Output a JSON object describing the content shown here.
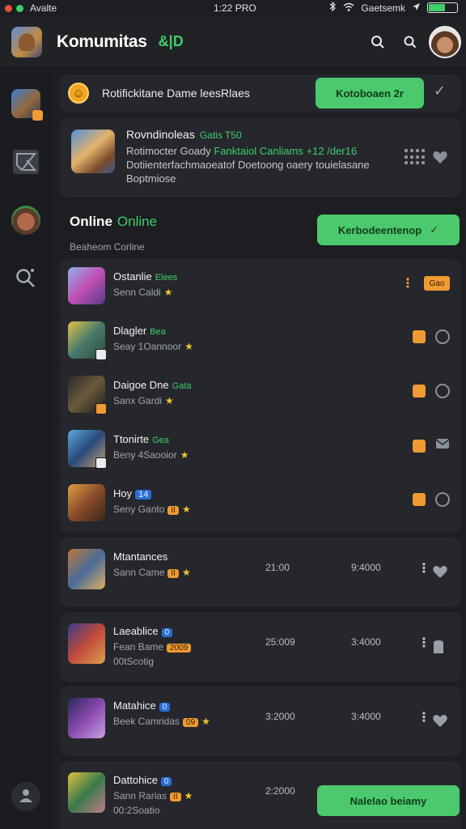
{
  "status": {
    "carrier": "Avalte",
    "time": "1:22 PRO",
    "network": "Gaetsemk"
  },
  "header": {
    "title": "Komumitas",
    "tag": "&|D"
  },
  "top_card": {
    "title": "Rotifickitane Dame leesRlaes",
    "button": "Kotoboaen 2r"
  },
  "featured": {
    "title": "Rovndinoleas",
    "title_tag": "Gatis T50",
    "line1_prefix": "Rotimocter Goady",
    "line1_highlight": "Fanktaiol Canliams",
    "line1_suffix": "+12 /der16",
    "line2": "Dotiienterfachmaoeatof Doetoong oaery touielasane",
    "line3": "Boptmiose"
  },
  "online": {
    "title": "Online",
    "title_tag": "Online",
    "subtitle": "Beaheom Corline",
    "button": "Kerbodeentenop"
  },
  "list": [
    {
      "name": "Ostanlie",
      "tag": "Elees",
      "sub": "Senn Caldi",
      "badge": "Gao"
    },
    {
      "name": "Dlagler",
      "tag": "Bea",
      "sub": "Seay 1Oannoor"
    },
    {
      "name": "Daigoe Dne",
      "tag": "Gata",
      "sub": "Sanx Gardi"
    },
    {
      "name": "Ttonirte",
      "tag": "Gea",
      "sub": "Beny 4Saooior"
    },
    {
      "name": "Hoy",
      "tag": "14",
      "sub": "Seny Ganto"
    }
  ],
  "cards": [
    {
      "name": "Mtantances",
      "sub": "Sann Came",
      "value1": "21:00",
      "value2": "9:4000"
    },
    {
      "name": "Laeablice",
      "tag": "0",
      "sub": "Fean Bame",
      "sub_badge": "2009",
      "sub2": "00tScotig",
      "value1": "25:009",
      "value2": "3:4000"
    },
    {
      "name": "Matahice",
      "tag": "0",
      "sub": "Beek Camridas",
      "sub_badge": "09",
      "value1": "3:2000",
      "value2": "3:4000"
    },
    {
      "name": "Dattohice",
      "tag": "0",
      "sub": "Sann Rarias",
      "sub2": "00:2Soatio",
      "value1": "2:2000"
    }
  ],
  "bottom_button": "Nalelao beiamy",
  "colors": {
    "accent": "#4cc96c",
    "badge": "#ef9a32",
    "background": "#1c1e22"
  }
}
